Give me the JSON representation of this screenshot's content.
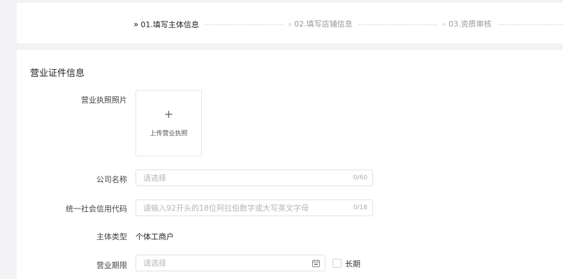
{
  "steps": [
    {
      "label": "01.填写主体信息",
      "active": true
    },
    {
      "label": "02.填写店铺信息",
      "active": false
    },
    {
      "label": "03.资质审核",
      "active": false
    }
  ],
  "section_title": "营业证件信息",
  "form": {
    "license_photo": {
      "label": "营业执照照片",
      "upload_plus": "+",
      "upload_text": "上传营业执照"
    },
    "company_name": {
      "label": "公司名称",
      "placeholder": "请选择",
      "value": "",
      "counter": "0/60"
    },
    "credit_code": {
      "label": "统一社会信用代码",
      "placeholder": "请输入92开头的18位阿拉伯数字或大写英文字母",
      "value": "",
      "counter": "0/18"
    },
    "entity_type": {
      "label": "主体类型",
      "value": "个体工商户"
    },
    "business_term": {
      "label": "营业期限",
      "placeholder": "请选择",
      "value": "",
      "icon": "calendar-icon",
      "long_term_label": "长期",
      "long_term_checked": false
    }
  },
  "colors": {
    "background": "#f3f3f6",
    "card": "#ffffff",
    "border": "#e1e1e6",
    "placeholder": "#b5b5bb"
  }
}
